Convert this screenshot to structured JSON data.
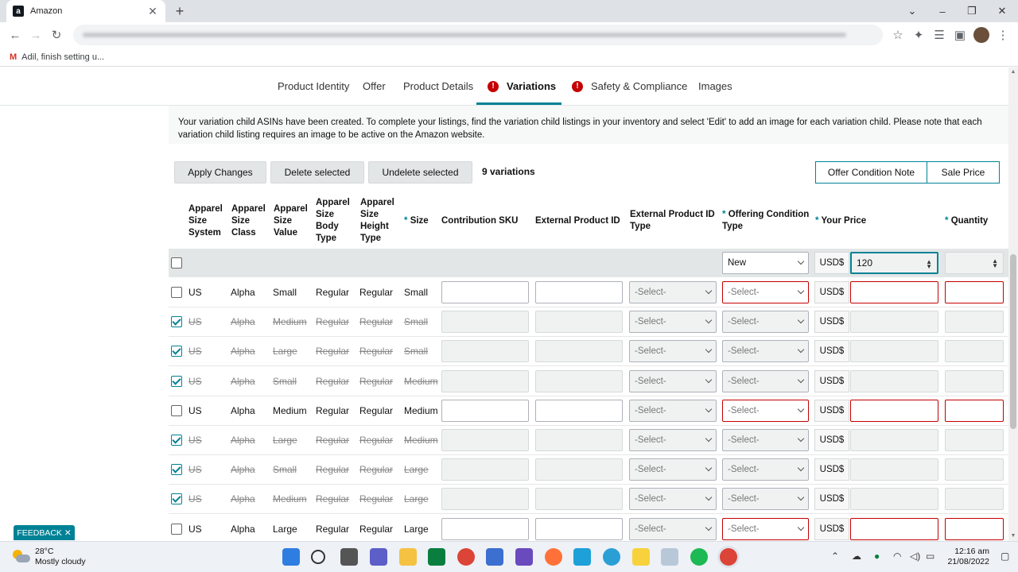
{
  "browser": {
    "tab_title": "Amazon",
    "favicon_letter": "a",
    "bookmark_label": "Adil, finish setting u...",
    "bookmark_icon": "gmail-icon"
  },
  "nav_tabs": [
    {
      "label": "Product Identity",
      "alert": false
    },
    {
      "label": "Offer",
      "alert": false
    },
    {
      "label": "Product Details",
      "alert": false
    },
    {
      "label": "Variations",
      "alert": true,
      "active": true
    },
    {
      "label": "Safety & Compliance",
      "alert": true
    },
    {
      "label": "Images",
      "alert": false
    }
  ],
  "notice": "Your variation child ASINs have been created. To complete your listings, find the variation child listings in your inventory and select 'Edit' to add an image for each variation child. Please note that each variation child listing requires an image to be active on the Amazon website.",
  "actions": {
    "apply": "Apply Changes",
    "delete": "Delete selected",
    "undelete": "Undelete selected",
    "count": "9 variations",
    "offer_note": "Offer Condition Note",
    "sale_price": "Sale Price"
  },
  "columns": {
    "system": "Apparel Size System",
    "class": "Apparel Size Class",
    "value": "Apparel Size Value",
    "body": "Apparel Size Body Type",
    "height": "Apparel Size Height Type",
    "size": "Size",
    "sku": "Contribution SKU",
    "ext_id": "External Product ID",
    "ext_type": "External Product ID Type",
    "condition": "Offering Condition Type",
    "price": "Your Price",
    "qty": "Quantity",
    "required_mark": "*"
  },
  "bulk_row": {
    "condition": "New",
    "currency": "USD$",
    "price": "120"
  },
  "select_placeholder": "-Select-",
  "currency": "USD$",
  "rows": [
    {
      "checked": false,
      "system": "US",
      "class": "Alpha",
      "value": "Small",
      "body": "Regular",
      "height": "Regular",
      "size": "Small"
    },
    {
      "checked": true,
      "system": "US",
      "class": "Alpha",
      "value": "Medium",
      "body": "Regular",
      "height": "Regular",
      "size": "Small"
    },
    {
      "checked": true,
      "system": "US",
      "class": "Alpha",
      "value": "Large",
      "body": "Regular",
      "height": "Regular",
      "size": "Small"
    },
    {
      "checked": true,
      "system": "US",
      "class": "Alpha",
      "value": "Small",
      "body": "Regular",
      "height": "Regular",
      "size": "Medium"
    },
    {
      "checked": false,
      "system": "US",
      "class": "Alpha",
      "value": "Medium",
      "body": "Regular",
      "height": "Regular",
      "size": "Medium"
    },
    {
      "checked": true,
      "system": "US",
      "class": "Alpha",
      "value": "Large",
      "body": "Regular",
      "height": "Regular",
      "size": "Medium"
    },
    {
      "checked": true,
      "system": "US",
      "class": "Alpha",
      "value": "Small",
      "body": "Regular",
      "height": "Regular",
      "size": "Large"
    },
    {
      "checked": true,
      "system": "US",
      "class": "Alpha",
      "value": "Medium",
      "body": "Regular",
      "height": "Regular",
      "size": "Large"
    },
    {
      "checked": false,
      "system": "US",
      "class": "Alpha",
      "value": "Large",
      "body": "Regular",
      "height": "Regular",
      "size": "Large"
    }
  ],
  "feedback": "FEEDBACK",
  "taskbar": {
    "temp": "28°C",
    "weather": "Mostly cloudy",
    "time": "12:16 am",
    "date": "21/08/2022"
  },
  "colors": {
    "accent": "#008296",
    "error": "#c40000"
  }
}
